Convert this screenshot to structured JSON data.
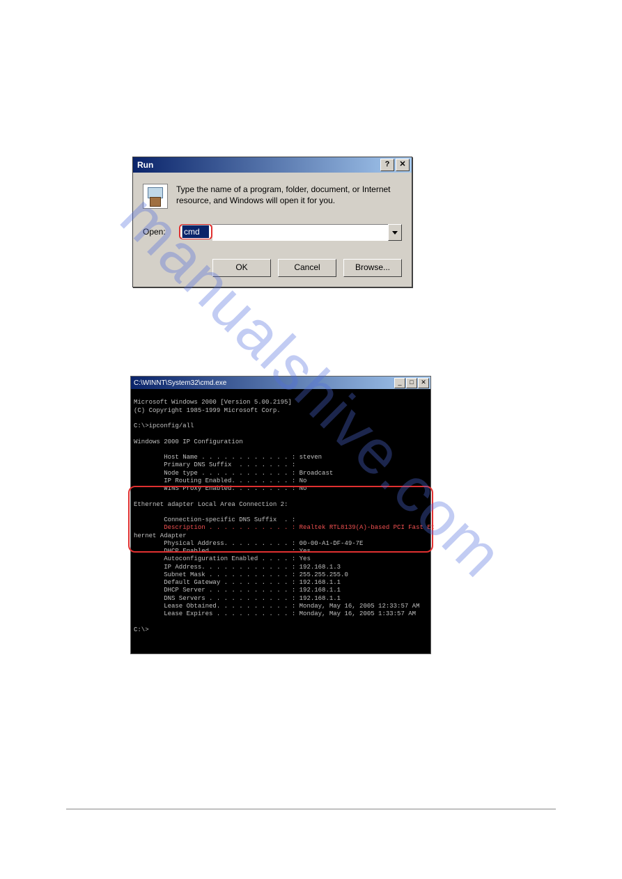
{
  "watermark": "manualshive.com",
  "run_dialog": {
    "title": "Run",
    "help_btn": "?",
    "close_btn": "✕",
    "description": "Type the name of a program, folder, document, or Internet resource, and Windows will open it for you.",
    "open_label": "Open:",
    "open_value": "cmd",
    "buttons": {
      "ok": "OK",
      "cancel": "Cancel",
      "browse": "Browse..."
    }
  },
  "cmd": {
    "title": "C:\\WINNT\\System32\\cmd.exe",
    "min_btn": "_",
    "max_btn": "□",
    "close_btn": "✕",
    "lines": {
      "l1": "Microsoft Windows 2000 [Version 5.00.2195]",
      "l2": "(C) Copyright 1985-1999 Microsoft Corp.",
      "l3": "",
      "l4": "C:\\>ipconfig/all",
      "l5": "",
      "l6": "Windows 2000 IP Configuration",
      "l7": "",
      "l8": "        Host Name . . . . . . . . . . . . : steven",
      "l9": "        Primary DNS Suffix  . . . . . . . :",
      "l10": "        Node type . . . . . . . . . . . . : Broadcast",
      "l11": "        IP Routing Enabled. . . . . . . . : No",
      "l12": "        WINS Proxy Enabled. . . . . . . . : No",
      "l13": "",
      "l14": "Ethernet adapter Local Area Connection 2:",
      "l15": "",
      "l16": "        Connection-specific DNS Suffix  . :",
      "l17": "        Description . . . . . . . . . . . : Realtek RTL8139(A)-based PCI Fast Et",
      "l18": "hernet Adapter",
      "l19": "        Physical Address. . . . . . . . . : 00-00-A1-DF-49-7E",
      "l20": "        DHCP Enabled. . . . . . . . . . . : Yes",
      "l21": "        Autoconfiguration Enabled . . . . : Yes",
      "l22": "        IP Address. . . . . . . . . . . . : 192.168.1.3",
      "l23": "        Subnet Mask . . . . . . . . . . . : 255.255.255.0",
      "l24": "        Default Gateway . . . . . . . . . : 192.168.1.1",
      "l25": "        DHCP Server . . . . . . . . . . . : 192.168.1.1",
      "l26": "        DNS Servers . . . . . . . . . . . : 192.168.1.1",
      "l27": "        Lease Obtained. . . . . . . . . . : Monday, May 16, 2005 12:33:57 AM",
      "l28": "        Lease Expires . . . . . . . . . . : Monday, May 16, 2005 1:33:57 AM",
      "l29": "",
      "l30": "C:\\>"
    }
  }
}
